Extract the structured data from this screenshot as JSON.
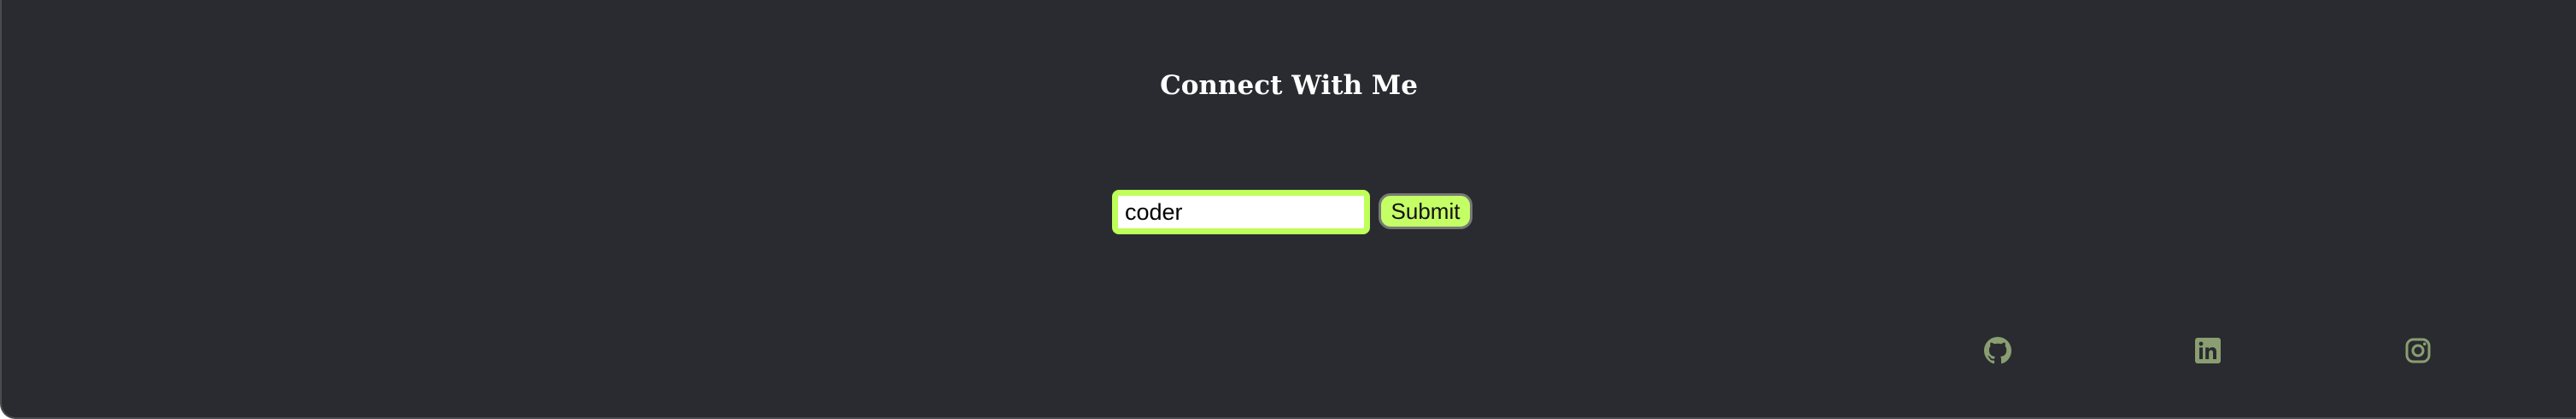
{
  "connect": {
    "heading": "Connect With Me"
  },
  "form": {
    "input_value": "coder",
    "submit_label": "Submit"
  },
  "social": [
    {
      "icon": "github-icon"
    },
    {
      "icon": "linkedin-icon"
    },
    {
      "icon": "instagram-icon"
    }
  ],
  "colors": {
    "background": "#2a2b30",
    "accent": "#bfff5a",
    "icon": "#8a9e72"
  }
}
